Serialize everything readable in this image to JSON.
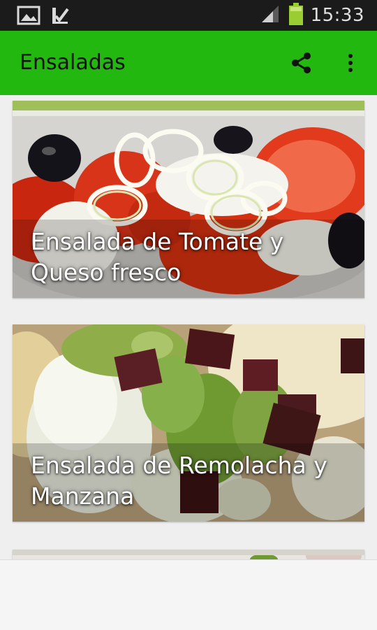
{
  "status_bar": {
    "time": "15:33",
    "icons": [
      "image-icon",
      "download-done-icon",
      "signal-icon",
      "battery-icon"
    ],
    "battery_color": "#9acd32"
  },
  "app_bar": {
    "title": "Ensaladas",
    "color": "#22b80f",
    "actions": [
      "share-icon",
      "overflow-menu-icon"
    ]
  },
  "recipes": [
    {
      "title": "Ensalada de Tomate y Queso fresco"
    },
    {
      "title": "Ensalada de Remolacha y Manzana"
    }
  ]
}
